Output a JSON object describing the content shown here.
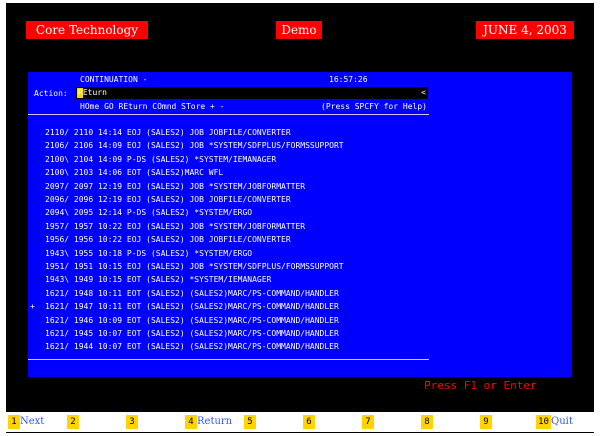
{
  "header": {
    "company": "Core Technology",
    "mode": "Demo",
    "date": "JUNE 4, 2003"
  },
  "screen": {
    "title": "CONTINUATION -",
    "time": "16:57:26",
    "action_label": "Action:",
    "action_value": "REturn",
    "action_end": "<",
    "commands": "HOme GO REturn COmnd STore + -",
    "help": "(Press SPCFY for Help)",
    "rows": [
      {
        "mark": "",
        "text": "2110/ 2110 14:14 EOJ  (SALES2) JOB JOBFILE/CONVERTER"
      },
      {
        "mark": "",
        "text": "2106/ 2106 14:09 EOJ  (SALES2) JOB *SYSTEM/SDFPLUS/FORMSSUPPORT"
      },
      {
        "mark": "",
        "text": "2100\\ 2104 14:09 P-DS (SALES2) *SYSTEM/IEMANAGER"
      },
      {
        "mark": "",
        "text": "2100\\ 2103 14:06 EOT  (SALES2)MARC  WFL"
      },
      {
        "mark": "",
        "text": "2097/ 2097 12:19 EOJ  (SALES2) JOB *SYSTEM/JOBFORMATTER"
      },
      {
        "mark": "",
        "text": "2096/ 2096 12:19 EOJ  (SALES2) JOB JOBFILE/CONVERTER"
      },
      {
        "mark": "",
        "text": "2094\\ 2095 12:14 P-DS (SALES2) *SYSTEM/ERGO"
      },
      {
        "mark": "",
        "text": "1957/ 1957 10:22 EOJ  (SALES2) JOB *SYSTEM/JOBFORMATTER"
      },
      {
        "mark": "",
        "text": "1956/ 1956 10:22 EOJ  (SALES2) JOB JOBFILE/CONVERTER"
      },
      {
        "mark": "",
        "text": "1943\\ 1955 10:18 P-DS (SALES2) *SYSTEM/ERGO"
      },
      {
        "mark": "",
        "text": "1951/ 1951 10:15 EOJ  (SALES2) JOB *SYSTEM/SDFPLUS/FORMSSUPPORT"
      },
      {
        "mark": "",
        "text": "1943\\ 1949 10:15 EOT  (SALES2) *SYSTEM/IEMANAGER"
      },
      {
        "mark": "",
        "text": "1621/ 1948 10:11 EOT  (SALES2) (SALES2)MARC/PS-COMMAND/HANDLER"
      },
      {
        "mark": "+",
        "text": "1621/ 1947 10:11 EOT  (SALES2) (SALES2)MARC/PS-COMMAND/HANDLER"
      },
      {
        "mark": "",
        "text": "1621/ 1946 10:09 EOT  (SALES2) (SALES2)MARC/PS-COMMAND/HANDLER"
      },
      {
        "mark": "",
        "text": "1621/ 1945 10:07 EOT  (SALES2) (SALES2)MARC/PS-COMMAND/HANDLER"
      },
      {
        "mark": "",
        "text": "1621/ 1944 10:07 EOT  (SALES2) (SALES2)MARC/PS-COMMAND/HANDLER"
      }
    ]
  },
  "prompt": "Press F1 or Enter",
  "fkeys": [
    {
      "num": "1",
      "label": "Next"
    },
    {
      "num": "2",
      "label": ""
    },
    {
      "num": "3",
      "label": ""
    },
    {
      "num": "4",
      "label": "Return"
    },
    {
      "num": "5",
      "label": ""
    },
    {
      "num": "6",
      "label": ""
    },
    {
      "num": "7",
      "label": ""
    },
    {
      "num": "8",
      "label": ""
    },
    {
      "num": "9",
      "label": ""
    },
    {
      "num": "10",
      "label": "Quit"
    }
  ],
  "colors": {
    "screen_bg": "#0000ff",
    "badge_bg": "#ff0000",
    "cursor": "#ffd400",
    "prompt": "#ff0000"
  }
}
